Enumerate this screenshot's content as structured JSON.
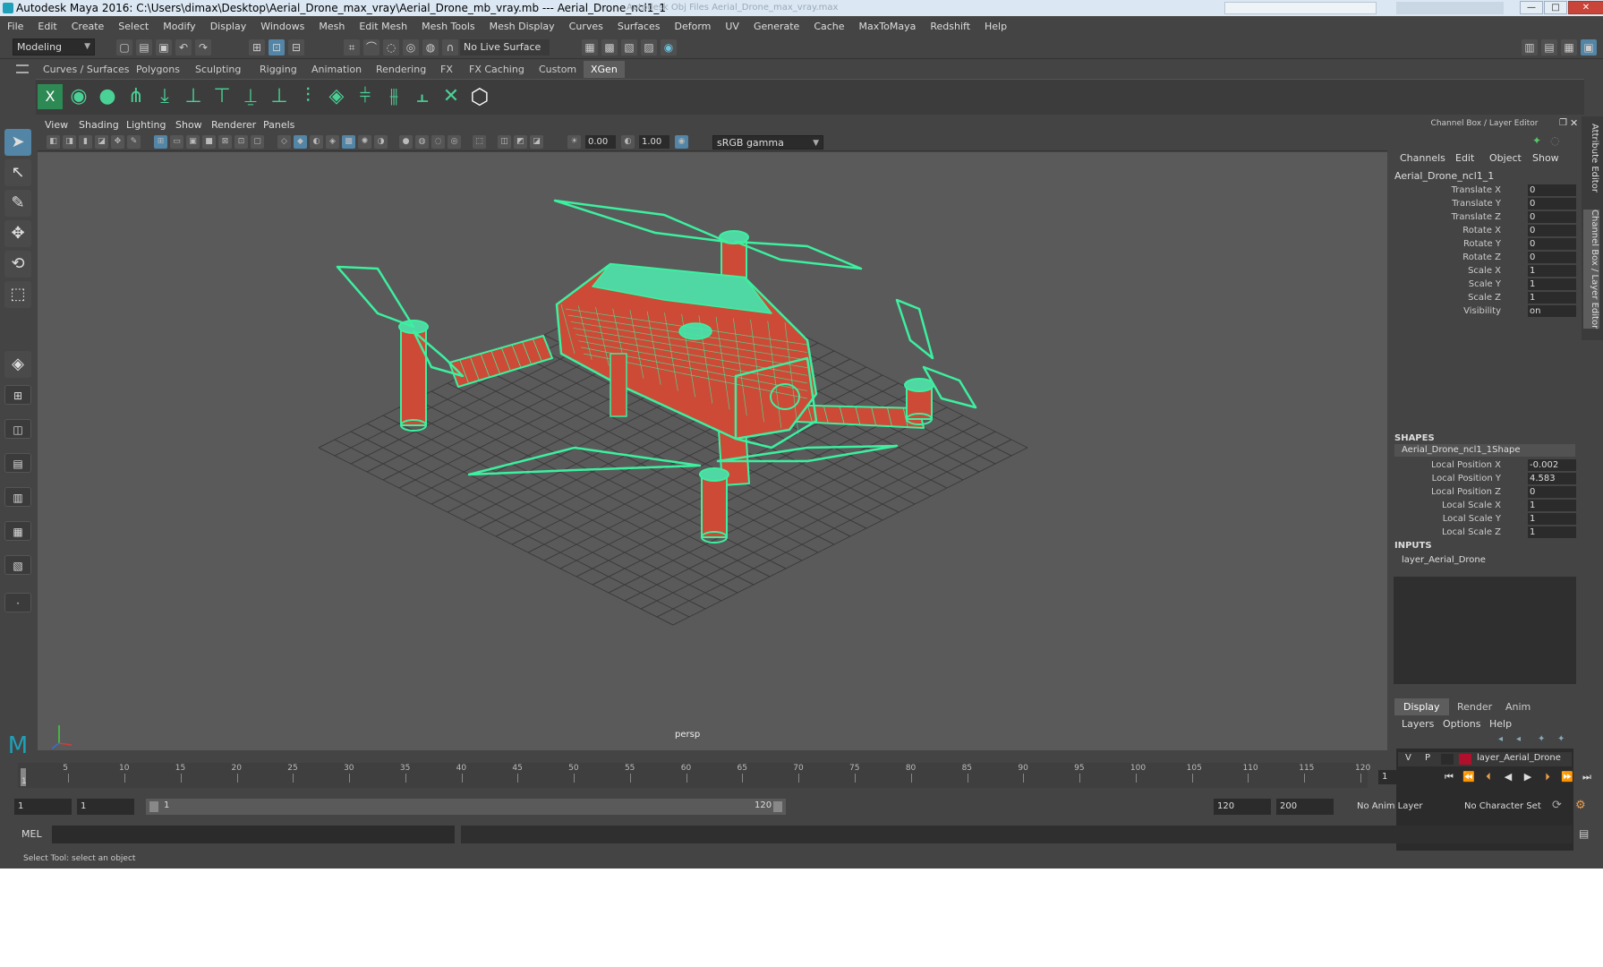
{
  "window": {
    "title": "Autodesk Maya 2016: C:\\Users\\dimax\\Desktop\\Aerial_Drone_max_vray\\Aerial_Drone_mb_vray.mb   ---   Aerial_Drone_ncl1_1",
    "ghost_title": "Autodesk Obj Files    Aerial_Drone_max_vray.max",
    "min_glyph": "—",
    "max_glyph": "□",
    "close_glyph": "✕"
  },
  "menubar": [
    "File",
    "Edit",
    "Create",
    "Select",
    "Modify",
    "Display",
    "Windows",
    "Mesh",
    "Edit Mesh",
    "Mesh Tools",
    "Mesh Display",
    "Curves",
    "Surfaces",
    "Deform",
    "UV",
    "Generate",
    "Cache",
    "MaxToMaya",
    "Redshift",
    "Help"
  ],
  "statusline": {
    "mode": "Modeling",
    "live_surface": "No Live Surface",
    "arrow": "▼"
  },
  "shelf": {
    "tabs": [
      "Curves / Surfaces",
      "Polygons",
      "Sculpting",
      "Rigging",
      "Animation",
      "Rendering",
      "FX",
      "FX Caching",
      "Custom",
      "XGen"
    ],
    "active_tab": "XGen"
  },
  "viewport": {
    "menu": [
      "View",
      "Shading",
      "Lighting",
      "Show",
      "Renderer",
      "Panels"
    ],
    "exposure": "0.00",
    "gamma_value": "1.00",
    "color_space": "sRGB gamma",
    "camera": "persp",
    "wire_color": "#3cf0a0",
    "surface_color": "#cc4a36"
  },
  "channel_box": {
    "title": "Channel Box / Layer Editor",
    "menu": [
      "Channels",
      "Edit",
      "Object",
      "Show"
    ],
    "object": "Aerial_Drone_ncl1_1",
    "attributes": [
      {
        "label": "Translate X",
        "value": "0"
      },
      {
        "label": "Translate Y",
        "value": "0"
      },
      {
        "label": "Translate Z",
        "value": "0"
      },
      {
        "label": "Rotate X",
        "value": "0"
      },
      {
        "label": "Rotate Y",
        "value": "0"
      },
      {
        "label": "Rotate Z",
        "value": "0"
      },
      {
        "label": "Scale X",
        "value": "1"
      },
      {
        "label": "Scale Y",
        "value": "1"
      },
      {
        "label": "Scale Z",
        "value": "1"
      },
      {
        "label": "Visibility",
        "value": "on"
      }
    ],
    "shapes_header": "SHAPES",
    "shape_name": "Aerial_Drone_ncl1_1Shape",
    "shape_attributes": [
      {
        "label": "Local Position X",
        "value": "-0.002"
      },
      {
        "label": "Local Position Y",
        "value": "4.583"
      },
      {
        "label": "Local Position Z",
        "value": "0"
      },
      {
        "label": "Local Scale X",
        "value": "1"
      },
      {
        "label": "Local Scale Y",
        "value": "1"
      },
      {
        "label": "Local Scale Z",
        "value": "1"
      }
    ],
    "inputs_header": "INPUTS",
    "input_name": "layer_Aerial_Drone"
  },
  "layer_editor": {
    "tabs": [
      "Display",
      "Render",
      "Anim"
    ],
    "active_tab": "Display",
    "menu": [
      "Layers",
      "Options",
      "Help"
    ],
    "layer": {
      "v": "V",
      "p": "P",
      "name": "layer_Aerial_Drone",
      "color": "#b0102c"
    }
  },
  "side_tabs": [
    "Attribute Editor",
    "Channel Box / Layer Editor"
  ],
  "timeline": {
    "ticks": [
      5,
      10,
      15,
      20,
      25,
      30,
      35,
      40,
      45,
      50,
      55,
      60,
      65,
      70,
      75,
      80,
      85,
      90,
      95,
      100,
      105,
      110,
      115,
      120
    ],
    "start_tick": "1",
    "min": 1,
    "max": 120,
    "current_frame": "1",
    "range_start": "1",
    "range_inner_start": "1",
    "range_inner_value": "1",
    "range_inner_end": "120",
    "range_end": "120",
    "anim_end": "200",
    "anim_layer": "No Anim Layer",
    "character_set": "No Character Set",
    "playback": [
      "⏮",
      "⏪",
      "⏴",
      "◀",
      "▶",
      "⏵",
      "⏩",
      "⏭"
    ]
  },
  "command_line": {
    "label": "MEL",
    "help": "Select Tool: select an object"
  }
}
